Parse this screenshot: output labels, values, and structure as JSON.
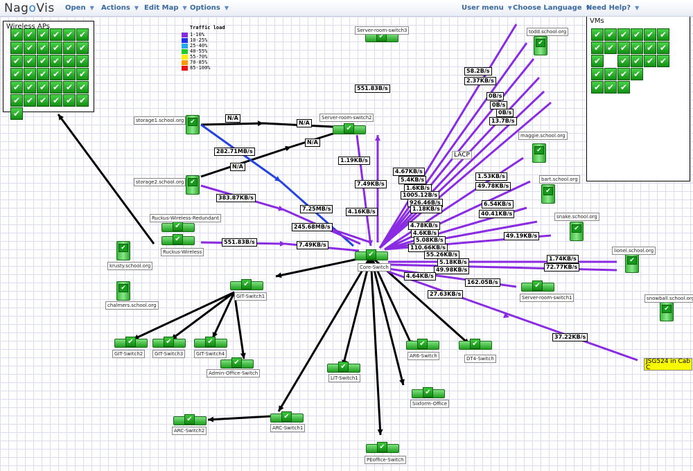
{
  "header": {
    "logo_left": "Nag",
    "logo_o": "o",
    "logo_right": "Vis",
    "menus_left": [
      {
        "label": "Open"
      },
      {
        "label": "Actions"
      },
      {
        "label": "Edit Map"
      },
      {
        "label": "Options"
      }
    ],
    "menus_right": [
      {
        "label": "User menu"
      },
      {
        "label": "Choose Language"
      },
      {
        "label": "Need Help?"
      }
    ]
  },
  "colors": {
    "black": "#000000",
    "purple": "#8a2be2",
    "blue": "#2244dd",
    "ok_green": "#1ea81e"
  },
  "legend": {
    "title": "Traffic load",
    "items": [
      {
        "label": "1-10%",
        "color": "#8a2be2"
      },
      {
        "label": "10-25%",
        "color": "#2233ee"
      },
      {
        "label": "25-40%",
        "color": "#22aaee"
      },
      {
        "label": "40-55%",
        "color": "#22cc22"
      },
      {
        "label": "55-70%",
        "color": "#ffee00"
      },
      {
        "label": "70-85%",
        "color": "#ff9900"
      },
      {
        "label": "85-100%",
        "color": "#ee1111"
      }
    ]
  },
  "wireless": {
    "title": "Wireless APs",
    "count": 37
  },
  "vms": {
    "title": "VMs",
    "count": 26
  },
  "icon_glyph": "✔",
  "nodes": {
    "core": "Core-Switch",
    "srs3": "Server-room-switch3",
    "srs2": "Server-room-switch2",
    "srs1": "Server-room-switch1",
    "storage1": "storage1.school.org",
    "storage2": "storage2.school.org",
    "ruckus_red": "Ruckus-Wireless-Redundant",
    "ruckus": "Ruckus-Wireless",
    "krusty": "krusty.school.org",
    "chalmers": "chalmers.school.org",
    "git1": "GIT-Switch1",
    "git2": "GIT-Switch2",
    "git3": "GIT-Switch3",
    "git4": "GIT-Switch4",
    "admin": "Admin-Office-Switch",
    "arc1": "ARC-Switch1",
    "arc2": "ARC-Switch2",
    "lit": "LIT-Switch1",
    "ar6": "AR6-Switch",
    "dt4": "DT4-Switch",
    "sixform": "Sixform-Office",
    "pe": "PEoffice-Switch",
    "todd": "todd.school.org",
    "maggie": "maggie.school.org",
    "bart": "bart.school.org",
    "snake": "snake.school.org",
    "lionel": "lionel.school.org",
    "snowball": "snowball.school.org"
  },
  "traffic_labels": {
    "t1": "N/A",
    "t2": "N/A",
    "t3": "N/A",
    "t4": "N/A",
    "t5": "282.71MB/s",
    "t6": "551.83B/s",
    "t7": "1.19KB/s",
    "t8": "7.49KB/s",
    "t9": "383.87KB/s",
    "t10": "7.25MB/s",
    "t11": "4.16KB/s",
    "t12": "245.68MB/s",
    "t13": "551.83B/s",
    "t14": "7.49KB/s",
    "t15": "58.2B/s",
    "t16": "2.37KB/s",
    "t17": "0B/s",
    "t18": "0B/s",
    "t19": "0B/s",
    "t20": "13.7B/s",
    "t21": "4.67KB/s",
    "t22": "5.4KB/s",
    "t23": "1.6KB/s",
    "t24": "1005.12B/s",
    "t25": "926.46B/s",
    "t26": "1.18KB/s",
    "t27": "1.53KB/s",
    "t28": "49.78KB/s",
    "t29": "6.54KB/s",
    "t30": "40.41KB/s",
    "t31": "4.78KB/s",
    "t32": "4.6KB/s",
    "t33": "5.08KB/s",
    "t34": "110.66KB/s",
    "t35": "49.19KB/s",
    "t36": "55.26KB/s",
    "t37": "5.18KB/s",
    "t38": "49.98KB/s",
    "t39": "1.74KB/s",
    "t40": "72.77KB/s",
    "t41": "4.64KB/s",
    "t42": "162.05B/s",
    "t43": "27.63KB/s",
    "t44": "37.22KB/s"
  },
  "lacp": "LACP",
  "jsg": "JSG524 in Cab C"
}
